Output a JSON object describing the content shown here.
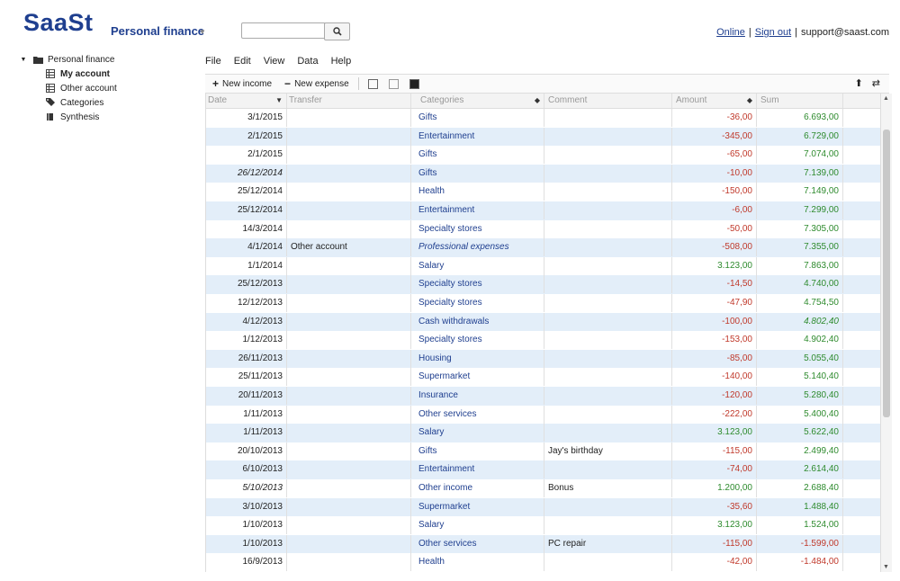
{
  "header": {
    "logo": "SaaSt",
    "app_name": "Personal finance",
    "search_placeholder": "",
    "links": {
      "online": "Online",
      "sign_out": "Sign out",
      "support": "support@saast.com"
    }
  },
  "sidebar": {
    "root": "Personal finance",
    "items": [
      {
        "label": "My account",
        "icon": "table-icon"
      },
      {
        "label": "Other account",
        "icon": "table-icon"
      },
      {
        "label": "Categories",
        "icon": "tags-icon"
      },
      {
        "label": "Synthesis",
        "icon": "book-icon"
      }
    ]
  },
  "menu": [
    "File",
    "Edit",
    "View",
    "Data",
    "Help"
  ],
  "toolbar": {
    "new_income": "New income",
    "new_expense": "New expense"
  },
  "columns": {
    "date": "Date",
    "transfer": "Transfer",
    "categories": "Categories",
    "comment": "Comment",
    "amount": "Amount",
    "sum": "Sum"
  },
  "rows": [
    {
      "date": "3/1/2015",
      "transfer": "",
      "category": "Gifts",
      "comment": "",
      "amount": "-36,00",
      "sum": "6.693,00"
    },
    {
      "date": "2/1/2015",
      "transfer": "",
      "category": "Entertainment",
      "comment": "",
      "amount": "-345,00",
      "sum": "6.729,00"
    },
    {
      "date": "2/1/2015",
      "transfer": "",
      "category": "Gifts",
      "comment": "",
      "amount": "-65,00",
      "sum": "7.074,00"
    },
    {
      "date": "26/12/2014",
      "transfer": "",
      "category": "Gifts",
      "comment": "",
      "amount": "-10,00",
      "sum": "7.139,00",
      "italic": true
    },
    {
      "date": "25/12/2014",
      "transfer": "",
      "category": "Health",
      "comment": "",
      "amount": "-150,00",
      "sum": "7.149,00"
    },
    {
      "date": "25/12/2014",
      "transfer": "",
      "category": "Entertainment",
      "comment": "",
      "amount": "-6,00",
      "sum": "7.299,00"
    },
    {
      "date": "14/3/2014",
      "transfer": "",
      "category": "Specialty stores",
      "comment": "",
      "amount": "-50,00",
      "sum": "7.305,00"
    },
    {
      "date": "4/1/2014",
      "transfer": "Other account",
      "category": "Professional expenses",
      "comment": "",
      "amount": "-508,00",
      "sum": "7.355,00",
      "italic_cat": true
    },
    {
      "date": "1/1/2014",
      "transfer": "",
      "category": "Salary",
      "comment": "",
      "amount": "3.123,00",
      "sum": "7.863,00"
    },
    {
      "date": "25/12/2013",
      "transfer": "",
      "category": "Specialty stores",
      "comment": "",
      "amount": "-14,50",
      "sum": "4.740,00"
    },
    {
      "date": "12/12/2013",
      "transfer": "",
      "category": "Specialty stores",
      "comment": "",
      "amount": "-47,90",
      "sum": "4.754,50"
    },
    {
      "date": "4/12/2013",
      "transfer": "",
      "category": "Cash withdrawals",
      "comment": "",
      "amount": "-100,00",
      "sum": "4.802,40",
      "italic_sum": true
    },
    {
      "date": "1/12/2013",
      "transfer": "",
      "category": "Specialty stores",
      "comment": "",
      "amount": "-153,00",
      "sum": "4.902,40"
    },
    {
      "date": "26/11/2013",
      "transfer": "",
      "category": "Housing",
      "comment": "",
      "amount": "-85,00",
      "sum": "5.055,40"
    },
    {
      "date": "25/11/2013",
      "transfer": "",
      "category": "Supermarket",
      "comment": "",
      "amount": "-140,00",
      "sum": "5.140,40"
    },
    {
      "date": "20/11/2013",
      "transfer": "",
      "category": "Insurance",
      "comment": "",
      "amount": "-120,00",
      "sum": "5.280,40"
    },
    {
      "date": "1/11/2013",
      "transfer": "",
      "category": "Other services",
      "comment": "",
      "amount": "-222,00",
      "sum": "5.400,40"
    },
    {
      "date": "1/11/2013",
      "transfer": "",
      "category": "Salary",
      "comment": "",
      "amount": "3.123,00",
      "sum": "5.622,40"
    },
    {
      "date": "20/10/2013",
      "transfer": "",
      "category": "Gifts",
      "comment": "Jay's birthday",
      "amount": "-115,00",
      "sum": "2.499,40"
    },
    {
      "date": "6/10/2013",
      "transfer": "",
      "category": "Entertainment",
      "comment": "",
      "amount": "-74,00",
      "sum": "2.614,40"
    },
    {
      "date": "5/10/2013",
      "transfer": "",
      "category": "Other income",
      "comment": "Bonus",
      "amount": "1.200,00",
      "sum": "2.688,40",
      "italic": true
    },
    {
      "date": "3/10/2013",
      "transfer": "",
      "category": "Supermarket",
      "comment": "",
      "amount": "-35,60",
      "sum": "1.488,40"
    },
    {
      "date": "1/10/2013",
      "transfer": "",
      "category": "Salary",
      "comment": "",
      "amount": "3.123,00",
      "sum": "1.524,00"
    },
    {
      "date": "1/10/2013",
      "transfer": "",
      "category": "Other services",
      "comment": "PC repair",
      "amount": "-115,00",
      "sum": "-1.599,00"
    },
    {
      "date": "16/9/2013",
      "transfer": "",
      "category": "Health",
      "comment": "",
      "amount": "-42,00",
      "sum": "-1.484,00"
    }
  ],
  "colors": {
    "brand": "#1f3f8f",
    "negative": "#c0392b",
    "positive": "#2e8b2e",
    "row_alt": "#e3eef9"
  }
}
